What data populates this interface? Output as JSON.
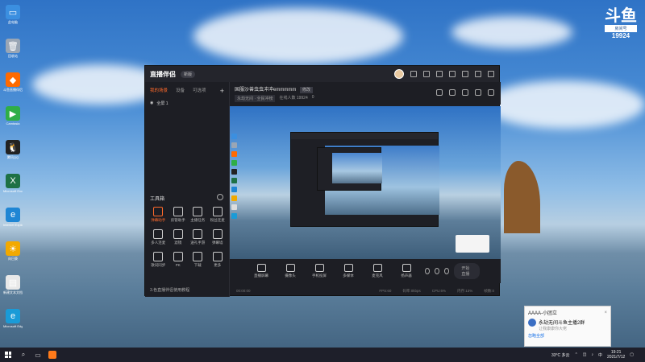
{
  "desktop": {
    "icons": [
      {
        "label": "此电脑",
        "color": "#3b8fe0",
        "glyph": "▭",
        "icon": "computer-icon"
      },
      {
        "label": "回收站",
        "color": "#9aa6b5",
        "glyph": "🗑",
        "icon": "recycle-bin-icon"
      },
      {
        "label": "斗鱼直播伴侣",
        "color": "#ff6a00",
        "glyph": "◆",
        "icon": "douyu-icon"
      },
      {
        "label": "Camtasia",
        "color": "#2fae47",
        "glyph": "▶",
        "icon": "camtasia-icon"
      },
      {
        "label": "腾讯QQ",
        "color": "#222222",
        "glyph": "🐧",
        "icon": "qq-icon"
      },
      {
        "label": "Microsoft Excel",
        "color": "#1e7145",
        "glyph": "X",
        "icon": "excel-icon"
      },
      {
        "label": "Internet Explorer",
        "color": "#1f86d4",
        "glyph": "e",
        "icon": "ie-icon"
      },
      {
        "label": "向日葵",
        "color": "#f2a900",
        "glyph": "☀",
        "icon": "sunflower-icon"
      },
      {
        "label": "新建文本文档",
        "color": "#e8e8e8",
        "glyph": "▤",
        "icon": "text-file-icon"
      },
      {
        "label": "Microsoft Edge",
        "color": "#1a9bd7",
        "glyph": "e",
        "icon": "edge-icon"
      }
    ]
  },
  "watermark": {
    "logo": "斗鱼",
    "sub": "房间号",
    "room": "19924"
  },
  "app": {
    "brand": "直播伴侣",
    "version_badge": "新版",
    "sidebar": {
      "tabs": [
        "我的场景",
        "设备",
        "可选项"
      ],
      "add": "+",
      "scene_name": "全屏 1",
      "tools_title": "工具箱",
      "tools": [
        {
          "label": "弹幕助手",
          "hot": true
        },
        {
          "label": "房管助手",
          "hot": false
        },
        {
          "label": "主播任务",
          "hot": false
        },
        {
          "label": "粉丝连麦",
          "hot": false
        },
        {
          "label": "多人连麦",
          "hot": false
        },
        {
          "label": "滤镜",
          "hot": false
        },
        {
          "label": "送礼手游",
          "hot": false
        },
        {
          "label": "弹幕墙",
          "hot": false
        },
        {
          "label": "歌词同步",
          "hot": false
        },
        {
          "label": "PK",
          "hot": false
        },
        {
          "label": "下载",
          "hot": false
        },
        {
          "label": "更多",
          "hot": false
        }
      ],
      "notice": "3.色直播伴侣使用教程"
    },
    "header": {
      "room_title": "国服沙兽虫虫冲冲emmmmm",
      "edit": "修改",
      "tag": "永劫无间 · 全民冲榜",
      "online_label": "在线人数 19924",
      "likes": "0"
    },
    "controls": [
      {
        "label": "直播屏幕",
        "icon": "screen-icon"
      },
      {
        "label": "摄像头",
        "icon": "camera-icon"
      },
      {
        "label": "手机投屏",
        "icon": "phone-cast-icon"
      },
      {
        "label": "多媒体",
        "icon": "media-icon"
      },
      {
        "label": "麦克风",
        "icon": "microphone-icon"
      },
      {
        "label": "扬声器",
        "icon": "speaker-icon"
      }
    ],
    "start_label": "开始直播",
    "status": [
      "00:00:00",
      "FPS:60",
      "码率:0kbps",
      "CPU:6%",
      "内存:13%",
      "帧数:0"
    ]
  },
  "popup": {
    "title": "AAAA-小团立",
    "message": "永劫无间斗鱼主播2群",
    "sub": "让我康康你大佬",
    "footer": "忽略全部"
  },
  "taskbar": {
    "weather": "33°C 多云",
    "ime": "中",
    "time": "19:21",
    "date": "2021/7/12"
  }
}
